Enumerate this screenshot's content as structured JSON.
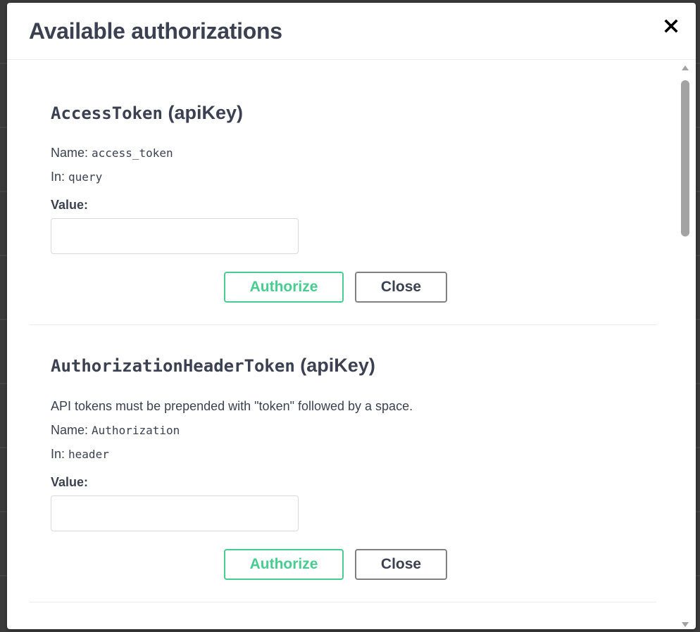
{
  "modal": {
    "title": "Available authorizations"
  },
  "auths": [
    {
      "name": "AccessToken",
      "type": "(apiKey)",
      "name_label": "Name:",
      "name_value": "access_token",
      "in_label": "In:",
      "in_value": "query",
      "value_label": "Value:",
      "value": "",
      "authorize_label": "Authorize",
      "close_label": "Close"
    },
    {
      "name": "AuthorizationHeaderToken",
      "type": "(apiKey)",
      "description": "API tokens must be prepended with \"token\" followed by a space.",
      "name_label": "Name:",
      "name_value": "Authorization",
      "in_label": "In:",
      "in_value": "header",
      "value_label": "Value:",
      "value": "",
      "authorize_label": "Authorize",
      "close_label": "Close"
    }
  ],
  "icons": {
    "close": "close-icon",
    "scroll_up": "scroll-up-arrow-icon",
    "scroll_down": "scroll-down-arrow-icon"
  },
  "colors": {
    "authorize": "#49cc90",
    "close_border": "#808080",
    "text": "#3b4151",
    "scroll_thumb": "#a3a3a3"
  }
}
